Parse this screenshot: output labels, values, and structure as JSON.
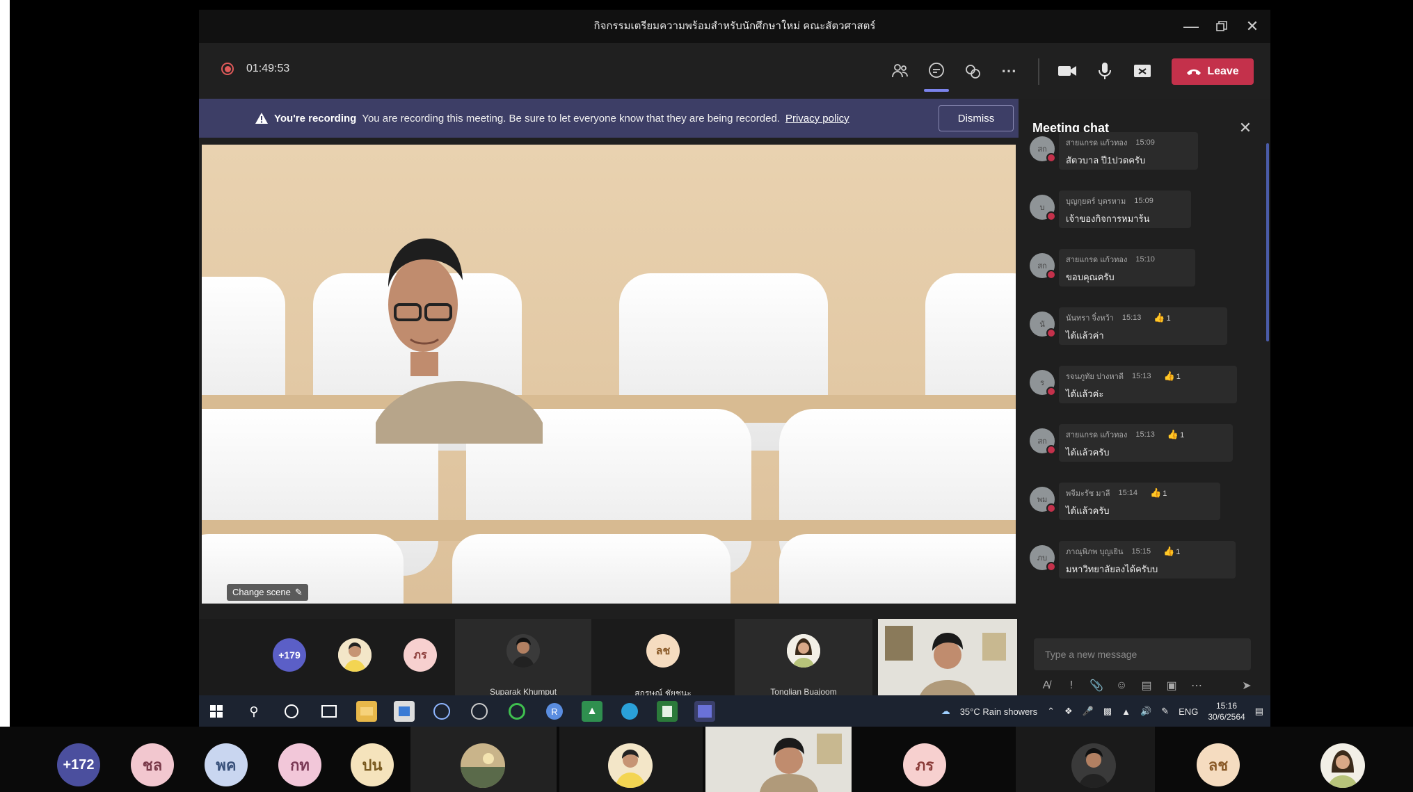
{
  "window": {
    "title": "กิจกรรมเตรียมความพร้อมสำหรับนักศึกษาใหม่ คณะสัตวศาสตร์"
  },
  "toolbar": {
    "timer": "01:49:53",
    "leave_label": "Leave"
  },
  "recording_banner": {
    "title": "You're recording",
    "message": "You are recording this meeting. Be sure to let everyone know that they are being recorded.",
    "link": "Privacy policy",
    "dismiss": "Dismiss"
  },
  "main_video": {
    "change_scene_label": "Change scene"
  },
  "chat": {
    "title": "Meeting chat",
    "compose_placeholder": "Type a new message",
    "messages": [
      {
        "avatar": "สก",
        "name": "สายแกรด แก้วทอง",
        "time": "15:09",
        "text": "สัตวบาล ปี1ปวดครับ",
        "reaction": ""
      },
      {
        "avatar": "บ",
        "name": "บุญกุยตร์ บุตรหาม",
        "time": "15:09",
        "text": "เจ้าของกิจการหมาร้น",
        "reaction": ""
      },
      {
        "avatar": "สก",
        "name": "สายแกรด แก้วทอง",
        "time": "15:10",
        "text": "ขอบคุณครับ",
        "reaction": ""
      },
      {
        "avatar": "นั",
        "name": "นันทรา จิ๋งหว้า",
        "time": "15:13",
        "text": "ได้แล้วค่า",
        "reaction": "1"
      },
      {
        "avatar": "ร",
        "name": "รจนภูทัย ปางหาดี",
        "time": "15:13",
        "text": "ได้แล้วค่ะ",
        "reaction": "1"
      },
      {
        "avatar": "สก",
        "name": "สายแกรด แก้วทอง",
        "time": "15:13",
        "text": "ได้แล้วครับ",
        "reaction": "1"
      },
      {
        "avatar": "พม",
        "name": "พจีมะรัช มาลี",
        "time": "15:14",
        "text": "ได้แล้วครับ",
        "reaction": "1"
      },
      {
        "avatar": "ภบ",
        "name": "ภาณุพิภพ บุญเยิน",
        "time": "15:15",
        "text": "มหาวิทยาลัยลงได้ครับบ",
        "reaction": "1"
      }
    ]
  },
  "participants": {
    "overflow_count": "+179",
    "pr_initials": "ภร",
    "tiles": [
      {
        "name": "Suparak Khumput"
      },
      {
        "name": "สุกรษณ์ ชัยชนะ",
        "initials": "ลช"
      },
      {
        "name": "Tonglian Buajoom"
      }
    ]
  },
  "taskbar": {
    "weather": "35°C  Rain showers",
    "language": "ENG",
    "time": "15:16",
    "date": "30/6/2564"
  },
  "bottom_strip": {
    "overflow_count": "+172",
    "avatars": [
      {
        "initials": "ชล",
        "bg": "#f2c7cf",
        "fg": "#7a3a4a"
      },
      {
        "initials": "พค",
        "bg": "#c9d6f0",
        "fg": "#38507a"
      },
      {
        "initials": "กท",
        "bg": "#f2c7d9",
        "fg": "#7a3a56"
      },
      {
        "initials": "ปน",
        "bg": "#f5e3bc",
        "fg": "#7a5a20"
      },
      {
        "initials": "ภร",
        "bg": "#f7d0cf",
        "fg": "#8a3b38"
      },
      {
        "initials": "ลช",
        "bg": "#f5dcc0",
        "fg": "#8a5a28"
      }
    ]
  },
  "colors": {
    "accent": "#7b83eb",
    "leave": "#c4314b",
    "banner": "#3d3e66"
  }
}
